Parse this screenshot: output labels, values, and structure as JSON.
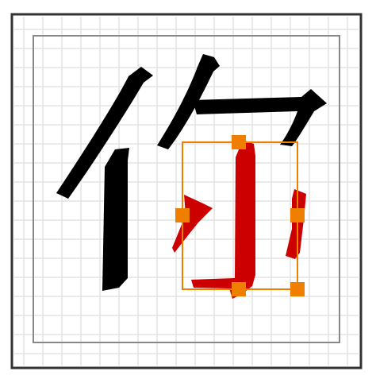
{
  "editor": {
    "character": "你",
    "selected_component": "小",
    "colors": {
      "background": "#ffffff",
      "outer_border": "#333333",
      "inner_border": "#888888",
      "grid": "#e4e4e4",
      "base_strokes": "#000000",
      "selected_strokes": "#cc0000",
      "selection": "#f07f00"
    },
    "icons": {
      "handle": "square-handle-icon"
    }
  }
}
